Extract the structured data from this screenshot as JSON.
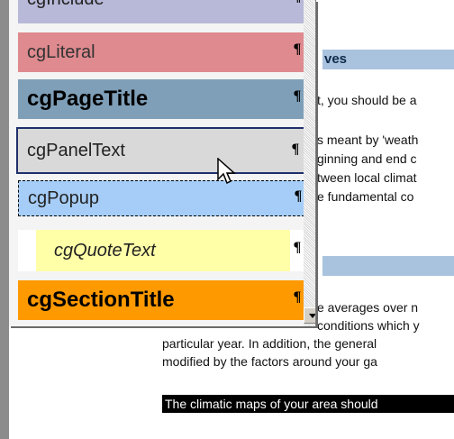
{
  "doc": {
    "heading1": "ves",
    "heading2": "",
    "lines": [
      "t, you should be a",
      "s meant by 'weath",
      "ginning and end c",
      "tween local climat",
      "e fundamental co",
      "e averages over n",
      "conditions which y",
      "particular year. In addition, the general",
      "modified by the factors around your ga"
    ],
    "highlight": "The climatic maps of your area should"
  },
  "styles": {
    "items": [
      {
        "label": "cgInclude",
        "pilcrow": "¶"
      },
      {
        "label": "cgLiteral",
        "pilcrow": "¶"
      },
      {
        "label": "cgPageTitle",
        "pilcrow": "¶"
      },
      {
        "label": "cgPanelText",
        "pilcrow": "¶"
      },
      {
        "label": "cgPopup",
        "pilcrow": "¶"
      },
      {
        "label": "cgQuoteText",
        "pilcrow": "¶"
      },
      {
        "label": "cgSectionTitle",
        "pilcrow": "¶"
      }
    ]
  },
  "colors": {
    "include": "#b8b8d8",
    "literal": "#de8a8f",
    "pagetitle": "#7f9fb8",
    "paneltext": "#d9d9d9",
    "popup": "#a6cdf7",
    "quote": "#ffffa8",
    "section": "#ff9900"
  },
  "icons": {
    "cursor": "arrow-cursor-icon",
    "scroll_down": "arrow-down-icon"
  }
}
